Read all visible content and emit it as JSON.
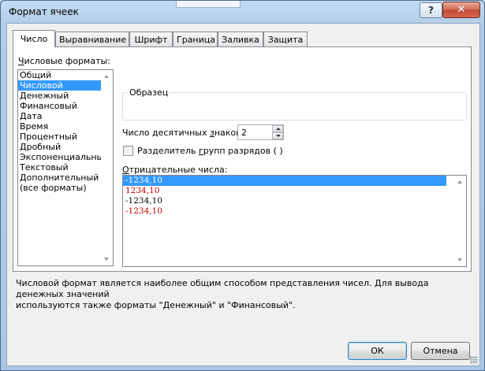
{
  "window": {
    "title": "Формат ячеек",
    "help_label": "?",
    "close_label": "✕"
  },
  "tabs": [
    {
      "label": "Число",
      "active": true
    },
    {
      "label": "Выравнивание",
      "active": false
    },
    {
      "label": "Шрифт",
      "active": false
    },
    {
      "label": "Граница",
      "active": false
    },
    {
      "label": "Заливка",
      "active": false
    },
    {
      "label": "Защита",
      "active": false
    }
  ],
  "number_formats": {
    "label_first": "Ч",
    "label_rest": "исловые форматы:",
    "items": [
      "Общий",
      "Числовой",
      "Денежный",
      "Финансовый",
      "Дата",
      "Время",
      "Процентный",
      "Дробный",
      "Экспоненциальный",
      "Текстовый",
      "Дополнительный",
      "(все форматы)"
    ],
    "selected_index": 1
  },
  "sample": {
    "label": "Образец",
    "value": ""
  },
  "decimal_places": {
    "label_before": "Число десятичных ",
    "label_underlined": "з",
    "label_after": "наков:",
    "value": "2"
  },
  "separator": {
    "label_before": "Разделитель ",
    "label_underlined": "г",
    "label_after": "рупп разрядов ( )",
    "checked": false
  },
  "negative_numbers": {
    "label_first": "О",
    "label_rest": "трицательные числа:",
    "items": [
      {
        "text": "-1234,10",
        "color": "#000000",
        "selected": true
      },
      {
        "text": "1234,10",
        "color": "#c00000",
        "selected": false
      },
      {
        "text": "-1234,10",
        "color": "#000000",
        "selected": false
      },
      {
        "text": "-1234,10",
        "color": "#c00000",
        "selected": false
      }
    ]
  },
  "description": {
    "line1": "Числовой формат является наиболее общим способом представления чисел. Для вывода денежных значений",
    "line2": "используются также форматы \"Денежный\" и \"Финансовый\"."
  },
  "buttons": {
    "ok": "ОК",
    "cancel": "Отмена"
  }
}
